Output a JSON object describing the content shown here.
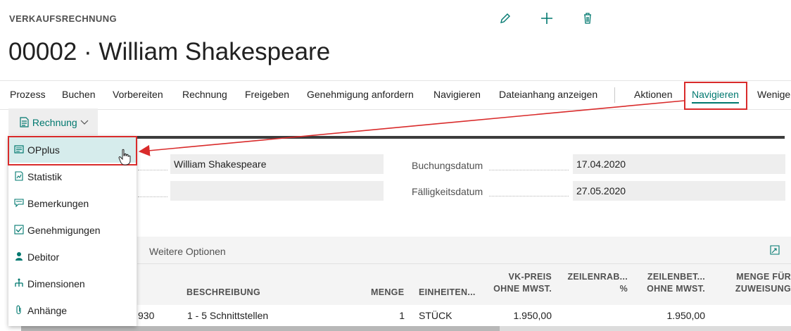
{
  "header": {
    "caption": "VERKAUFSRECHNUNG",
    "title": "00002 · William Shakespeare"
  },
  "toolbar_icons": [
    "edit-icon",
    "add-icon",
    "delete-icon"
  ],
  "actions": [
    "Prozess",
    "Buchen",
    "Vorbereiten",
    "Rechnung",
    "Freigeben",
    "Genehmigung anfordern",
    "Navigieren",
    "Dateianhang anzeigen"
  ],
  "actions_right": {
    "aktionen": "Aktionen",
    "navigieren": "Navigieren",
    "weniger": "Wenige"
  },
  "sub_menu": {
    "label": "Rechnung"
  },
  "dropdown": {
    "items": [
      {
        "label": "OPplus",
        "icon": "opplus-icon"
      },
      {
        "label": "Statistik",
        "icon": "statistics-icon"
      },
      {
        "label": "Bemerkungen",
        "icon": "comment-icon"
      },
      {
        "label": "Genehmigungen",
        "icon": "approvals-icon"
      },
      {
        "label": "Debitor",
        "icon": "customer-icon"
      },
      {
        "label": "Dimensionen",
        "icon": "dimensions-icon"
      },
      {
        "label": "Anhänge",
        "icon": "attachment-icon"
      }
    ]
  },
  "fields": {
    "customer_name": "William Shakespeare",
    "customer_extra": "",
    "posting_date_label": "Buchungsdatum",
    "posting_date": "17.04.2020",
    "due_date_label": "Fälligkeitsdatum",
    "due_date": "27.05.2020"
  },
  "lines": {
    "more_options": "Weitere Optionen",
    "headers": {
      "description": "BESCHREIBUNG",
      "quantity": "MENGE",
      "unit": "EINHEITEN...",
      "price_1": "VK-PREIS",
      "price_2": "OHNE MWST.",
      "discount_1": "ZEILENRAB...",
      "discount_2": "%",
      "amount_1": "ZEILENBET...",
      "amount_2": "OHNE MWST.",
      "assign_1": "MENGE FÜR",
      "assign_2": "ZUWEISUNG"
    },
    "row": {
      "no_fragment": "930",
      "description": "1 - 5 Schnittstellen",
      "quantity": "1",
      "unit": "STÜCK",
      "price": "1.950,00",
      "amount": "1.950,00"
    }
  },
  "colors": {
    "accent": "#00786f",
    "highlight_box": "#d92b2b"
  }
}
